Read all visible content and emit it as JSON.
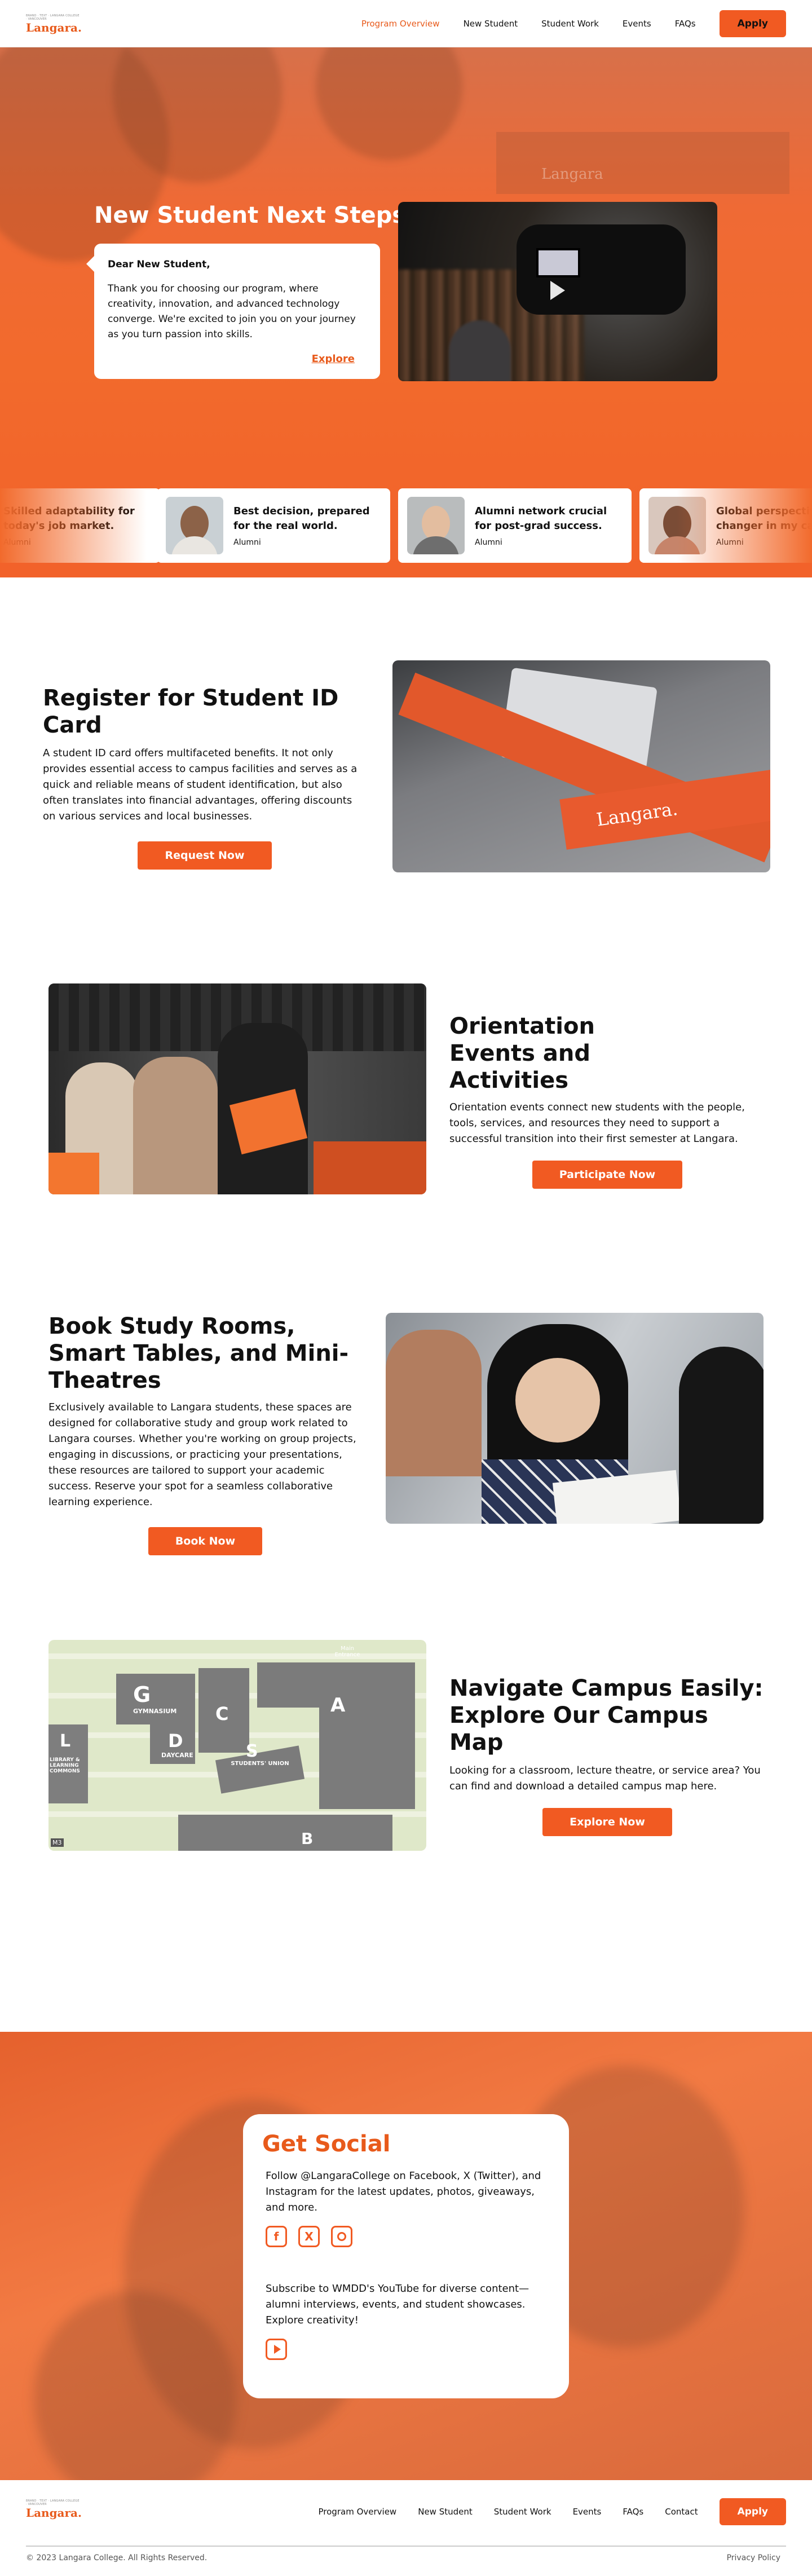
{
  "header": {
    "logo_text": "Langara.",
    "logo_tagline": "BRAND · TEXT · LANGARA COLLEGE · VANCOUVER",
    "nav": [
      "Program Overview",
      "New Student",
      "Student Work",
      "Events",
      "FAQs"
    ],
    "apply": "Apply"
  },
  "hero": {
    "title": "New Student Next Steps",
    "building_sign": "Langara",
    "card": {
      "greeting": "Dear New Student,",
      "body": "Thank you for choosing our program, where creativity, innovation, and advanced technology converge. We're excited to join you on your journey as you turn passion into skills.",
      "link": "Explore"
    },
    "testimonials": [
      {
        "quote": "Skilled adaptability for today's job market.",
        "role": "Alumni"
      },
      {
        "quote": "Best decision, prepared for the real world.",
        "role": "Alumni"
      },
      {
        "quote": "Alumni network crucial for post-grad success.",
        "role": "Alumni"
      },
      {
        "quote": "Global perspective, a changer in my career.",
        "role": "Alumni"
      }
    ]
  },
  "id_card": {
    "title": "Register for Student ID Card",
    "body": "A student ID card offers multifaceted benefits. It not only provides essential access to campus facilities and serves as a quick and reliable means of student identification, but also often translates into financial advantages, offering discounts on various services and local businesses.",
    "button": "Request Now",
    "lanyard_text": "Langara."
  },
  "orientation": {
    "title": "Orientation Events and Activities",
    "body": "Orientation events connect new students with the people, tools, services, and resources they need to support a successful transition into their first semester at Langara.",
    "button": "Participate Now"
  },
  "study_rooms": {
    "title": "Book Study Rooms, Smart Tables, and Mini-Theatres",
    "body": "Exclusively available to Langara students, these spaces are designed for collaborative study and group work related to Langara courses. Whether you're working on group projects, engaging in discussions, or practicing your presentations, these resources are tailored to support your academic success. Reserve your spot for a seamless collaborative learning experience.",
    "button": "Book Now"
  },
  "campus_map": {
    "title": "Navigate Campus Easily: Explore Our Campus Map",
    "body": "Looking for a classroom, lecture theatre, or service area? You can find and download a detailed campus map here.",
    "button": "Explore Now",
    "labels": {
      "g": "G",
      "gym": "GYMNASIUM",
      "d": "D",
      "daycare": "DAYCARE",
      "c": "C",
      "a": "A",
      "s": "S",
      "union": "STUDENTS' UNION",
      "l": "L",
      "library": "LIBRARY & LEARNING COMMONS",
      "b": "B",
      "main": "Main Entrance",
      "m3": "M3"
    }
  },
  "social": {
    "title": "Get Social",
    "text1": "Follow @LangaraCollege on Facebook, X (Twitter), and Instagram for the latest updates, photos, giveaways, and more.",
    "text2": "Subscribe to WMDD's YouTube for diverse content—alumni interviews, events, and student showcases. Explore creativity!",
    "icons": [
      "facebook-icon",
      "x-twitter-icon",
      "instagram-icon",
      "youtube-icon"
    ]
  },
  "footer": {
    "nav": [
      "Program Overview",
      "New Student",
      "Student Work",
      "Events",
      "FAQs",
      "Contact"
    ],
    "apply": "Apply",
    "copyright": "© 2023 Langara College. All Rights Reserved.",
    "privacy": "Privacy Policy"
  },
  "colors": {
    "brand": "#f15a22",
    "brand_text": "#e85a1b"
  }
}
